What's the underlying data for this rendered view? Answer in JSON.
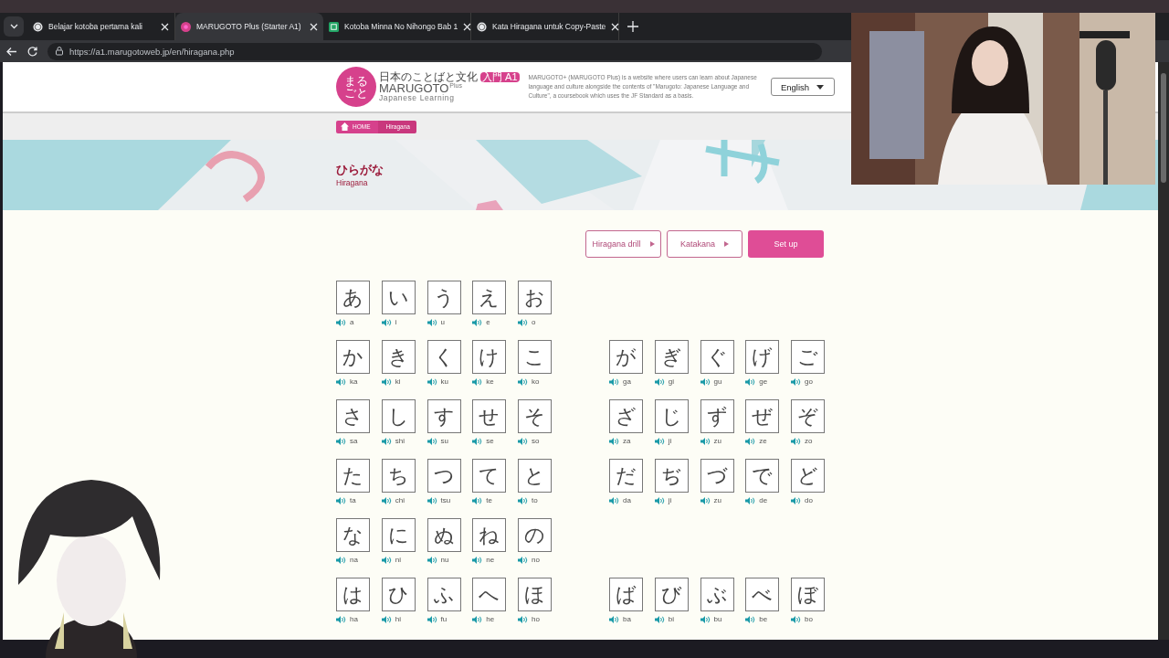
{
  "browser": {
    "tabs": [
      {
        "title": "Belajar kotoba pertama kali",
        "selected": false,
        "kind": "globe"
      },
      {
        "title": "MARUGOTO Plus (Starter A1)",
        "selected": true,
        "kind": "logo"
      },
      {
        "title": "Kotoba Minna No Nihongo Bab 1",
        "selected": false,
        "kind": "sheet"
      },
      {
        "title": "Kata Hiragana untuk Copy-Paste",
        "selected": false,
        "kind": "globe"
      }
    ],
    "url": "https://a1.marugotoweb.jp/en/hiragana.php"
  },
  "header": {
    "logo_mark": "まるごと",
    "logo_tagline": "日本のことばと文化",
    "logo_badge": "入門 A1",
    "logo_name": "MARUGOTO",
    "logo_plus": "Plus",
    "logo_sub": "Japanese Learning",
    "description": "MARUGOTO+ (MARUGOTO Plus) is a website where users can learn about Japanese language and culture alongside the contents of \"Marugoto: Japanese Language and Culture\", a coursebook which uses the JF Standard as a basis.",
    "language": "English"
  },
  "breadcrumb": [
    "HOME",
    "Hiragana"
  ],
  "banner": {
    "title": "ひらがな",
    "subtitle": "Hiragana"
  },
  "buttons": [
    {
      "label": "Hiragana drill",
      "kind": "outline"
    },
    {
      "label": "Katakana",
      "kind": "outline"
    },
    {
      "label": "Set up",
      "kind": "primary"
    }
  ],
  "rows": [
    {
      "basic": [
        {
          "kana": "あ",
          "romaji": "a"
        },
        {
          "kana": "い",
          "romaji": "i"
        },
        {
          "kana": "う",
          "romaji": "u"
        },
        {
          "kana": "え",
          "romaji": "e"
        },
        {
          "kana": "お",
          "romaji": "o"
        }
      ]
    },
    {
      "basic": [
        {
          "kana": "か",
          "romaji": "ka"
        },
        {
          "kana": "き",
          "romaji": "ki"
        },
        {
          "kana": "く",
          "romaji": "ku"
        },
        {
          "kana": "け",
          "romaji": "ke"
        },
        {
          "kana": "こ",
          "romaji": "ko"
        }
      ],
      "voiced": [
        {
          "kana": "が",
          "romaji": "ga"
        },
        {
          "kana": "ぎ",
          "romaji": "gi"
        },
        {
          "kana": "ぐ",
          "romaji": "gu"
        },
        {
          "kana": "げ",
          "romaji": "ge"
        },
        {
          "kana": "ご",
          "romaji": "go"
        }
      ]
    },
    {
      "basic": [
        {
          "kana": "さ",
          "romaji": "sa"
        },
        {
          "kana": "し",
          "romaji": "shi"
        },
        {
          "kana": "す",
          "romaji": "su"
        },
        {
          "kana": "せ",
          "romaji": "se"
        },
        {
          "kana": "そ",
          "romaji": "so"
        }
      ],
      "voiced": [
        {
          "kana": "ざ",
          "romaji": "za"
        },
        {
          "kana": "じ",
          "romaji": "ji"
        },
        {
          "kana": "ず",
          "romaji": "zu"
        },
        {
          "kana": "ぜ",
          "romaji": "ze"
        },
        {
          "kana": "ぞ",
          "romaji": "zo"
        }
      ]
    },
    {
      "basic": [
        {
          "kana": "た",
          "romaji": "ta"
        },
        {
          "kana": "ち",
          "romaji": "chi"
        },
        {
          "kana": "つ",
          "romaji": "tsu"
        },
        {
          "kana": "て",
          "romaji": "te"
        },
        {
          "kana": "と",
          "romaji": "to"
        }
      ],
      "voiced": [
        {
          "kana": "だ",
          "romaji": "da"
        },
        {
          "kana": "ぢ",
          "romaji": "ji"
        },
        {
          "kana": "づ",
          "romaji": "zu"
        },
        {
          "kana": "で",
          "romaji": "de"
        },
        {
          "kana": "ど",
          "romaji": "do"
        }
      ]
    },
    {
      "basic": [
        {
          "kana": "な",
          "romaji": "na"
        },
        {
          "kana": "に",
          "romaji": "ni"
        },
        {
          "kana": "ぬ",
          "romaji": "nu"
        },
        {
          "kana": "ね",
          "romaji": "ne"
        },
        {
          "kana": "の",
          "romaji": "no"
        }
      ]
    },
    {
      "basic": [
        {
          "kana": "は",
          "romaji": "ha"
        },
        {
          "kana": "ひ",
          "romaji": "hi"
        },
        {
          "kana": "ふ",
          "romaji": "fu"
        },
        {
          "kana": "へ",
          "romaji": "he"
        },
        {
          "kana": "ほ",
          "romaji": "ho"
        }
      ],
      "voiced": [
        {
          "kana": "ば",
          "romaji": "ba"
        },
        {
          "kana": "び",
          "romaji": "bi"
        },
        {
          "kana": "ぶ",
          "romaji": "bu"
        },
        {
          "kana": "べ",
          "romaji": "be"
        },
        {
          "kana": "ぼ",
          "romaji": "bo"
        }
      ]
    }
  ]
}
